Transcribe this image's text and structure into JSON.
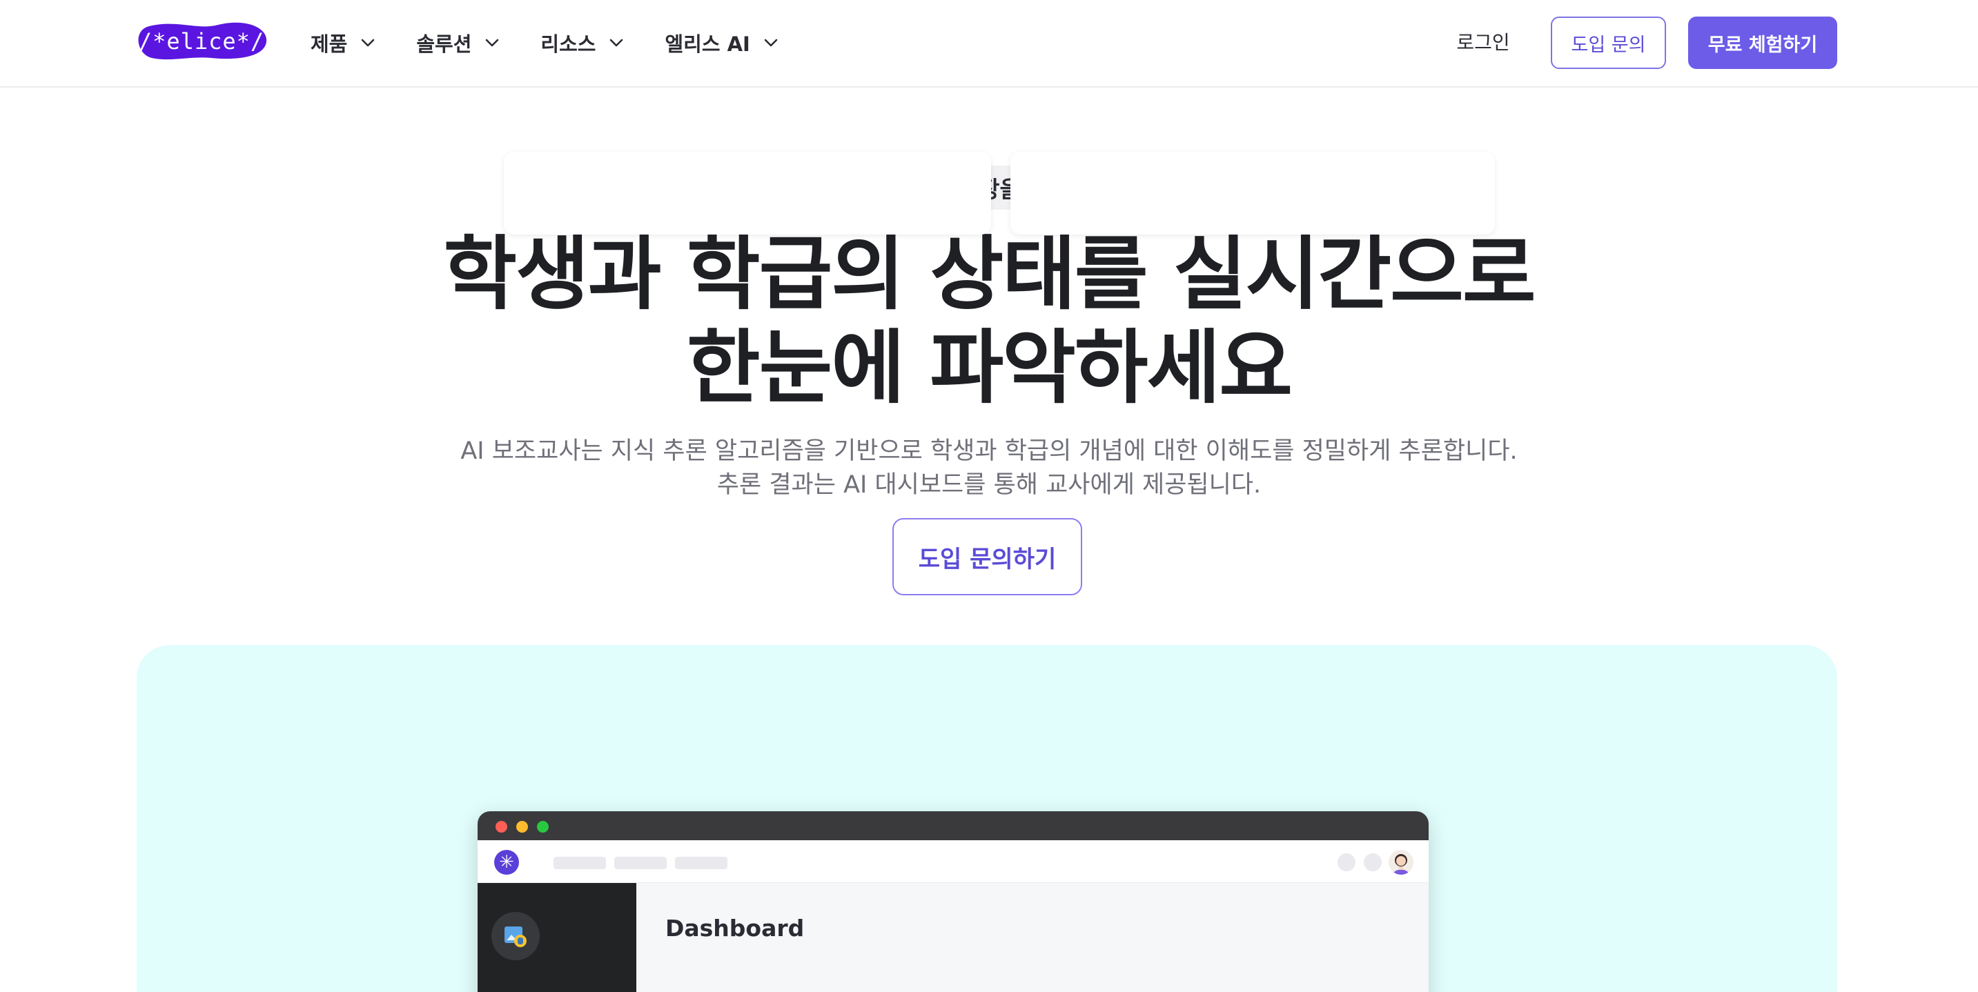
{
  "header": {
    "logo_text": "/*elice*/",
    "nav": [
      {
        "label": "제품",
        "icon": "chevron-down-icon"
      },
      {
        "label": "솔루션",
        "icon": "chevron-down-icon"
      },
      {
        "label": "리소스",
        "icon": "chevron-down-icon"
      },
      {
        "label": "엘리스 AI",
        "icon": "chevron-down-icon"
      }
    ],
    "login_label": "로그인",
    "inquiry_label": "도입 문의",
    "trial_label": "무료 체험하기"
  },
  "hero": {
    "badge_icon": "chart-presentation-icon",
    "badge_label": "교육 현장을 위한 AI",
    "title_line1": "학생과 학급의 상태를 실시간으로",
    "title_line2": "한눈에 파악하세요",
    "subtitle_line1": "AI 보조교사는 지식 추론 알고리즘을 기반으로 학생과 학급의 개념에 대한 이해도를 정밀하게 추론합니다.",
    "subtitle_line2": "추론 결과는 AI 대시보드를 통해 교사에게 제공됩니다.",
    "cta_label": "도입 문의하기"
  },
  "preview": {
    "dashboard_title": "Dashboard",
    "app_logo_glyph": "✳"
  },
  "colors": {
    "brand_purple": "#6c5ce7",
    "logo_purple": "#5a16e0",
    "showcase_bg": "#e1fefd"
  }
}
